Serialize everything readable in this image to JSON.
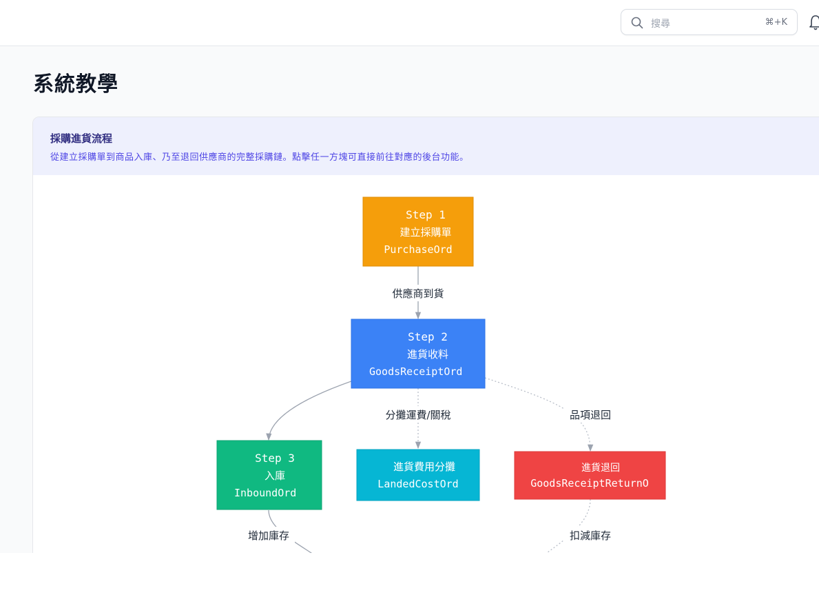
{
  "search": {
    "placeholder": "搜尋",
    "shortcut": "⌘+K"
  },
  "page": {
    "title": "系統教學"
  },
  "card": {
    "title": "採購進貨流程",
    "description": "從建立採購單到商品入庫、乃至退回供應商的完整採購鏈。點擊任一方塊可直接前往對應的後台功能。"
  },
  "diagram": {
    "nodes": [
      {
        "id": "purchase",
        "step": "Step 1",
        "label": "建立採購單",
        "code": "PurchaseOrd",
        "color": "#f59e0b"
      },
      {
        "id": "goods-receipt",
        "step": "Step 2",
        "label": "進貨收料",
        "code": "GoodsReceiptOrd",
        "color": "#3b82f6"
      },
      {
        "id": "inbound",
        "step": "Step 3",
        "label": "入庫",
        "code": "InboundOrd",
        "color": "#10b981"
      },
      {
        "id": "landed-cost",
        "label": "進貨費用分攤",
        "code": "LandedCostOrd",
        "color": "#06b6d4"
      },
      {
        "id": "return",
        "label": "進貨退回",
        "code": "GoodsReceiptReturnO",
        "color": "#ef4444"
      }
    ],
    "edges": [
      {
        "label": "供應商到貨"
      },
      {
        "label": "分攤運費/關稅"
      },
      {
        "label": "品項退回"
      },
      {
        "label": "增加庫存"
      },
      {
        "label": "扣減庫存"
      }
    ]
  }
}
